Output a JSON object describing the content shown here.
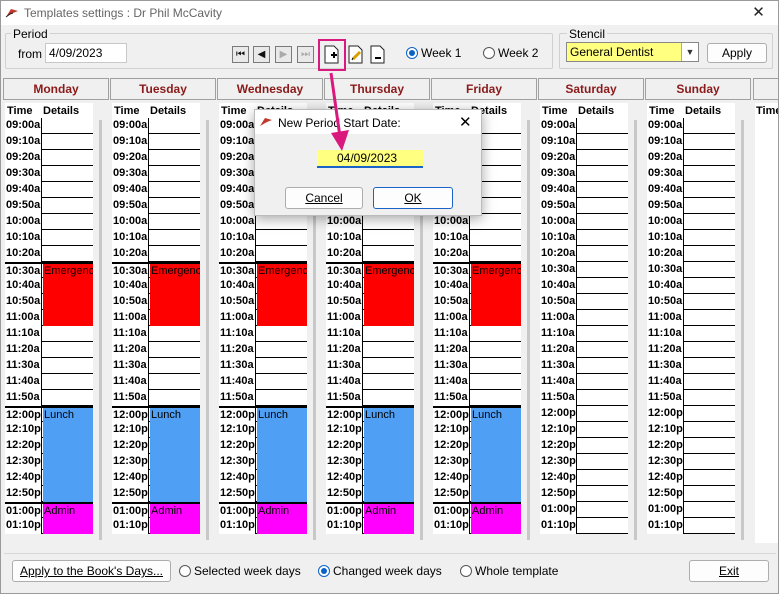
{
  "window": {
    "title": "Templates settings : Dr Phil McCavity",
    "close_glyph": "✕",
    "icon": "app-logo-icon"
  },
  "period": {
    "legend": "Period",
    "from_label": "from",
    "from_value": "4/09/2023",
    "nav_icons": [
      "first-icon",
      "prev-icon",
      "next-icon",
      "last-icon"
    ],
    "new_period_icon": "new-document-icon",
    "edit_period_icon": "edit-document-icon",
    "delete_period_icon": "delete-document-icon"
  },
  "weeks": {
    "week1": "Week 1",
    "week2": "Week 2",
    "selected": "Week 1"
  },
  "stencil": {
    "legend": "Stencil",
    "value": "General Dentist",
    "apply_label": "Apply"
  },
  "days": [
    "Monday",
    "Tuesday",
    "Wednesday",
    "Thursday",
    "Friday",
    "Saturday",
    "Sunday"
  ],
  "extra_day_header": "",
  "grid_headers": {
    "time": "Time",
    "details": "Details"
  },
  "times": [
    "09:00a",
    "09:10a",
    "09:20a",
    "09:30a",
    "09:40a",
    "09:50a",
    "10:00a",
    "10:10a",
    "10:20a",
    "10:30a",
    "10:40a",
    "10:50a",
    "11:00a",
    "11:10a",
    "11:20a",
    "11:30a",
    "11:40a",
    "11:50a",
    "12:00p",
    "12:10p",
    "12:20p",
    "12:30p",
    "12:40p",
    "12:50p",
    "01:00p",
    "01:10p"
  ],
  "blocks": [
    {
      "label": "Emergency",
      "start": 9,
      "end": 12,
      "color": "#ff0000"
    },
    {
      "label": "Lunch",
      "start": 18,
      "end": 23,
      "color": "#4f9ff5"
    },
    {
      "label": "Admin",
      "start": 24,
      "end": 25,
      "color": "#ff00ff"
    }
  ],
  "weekday_count": 5,
  "bottom": {
    "apply_book_label": "Apply to the Book's Days...",
    "selected_week_days": "Selected week days",
    "changed_week_days": "Changed week days",
    "whole_template": "Whole template",
    "selected": "Changed week days",
    "exit_label": "Exit"
  },
  "dialog": {
    "title": "New Period Start Date:",
    "value": "04/09/2023",
    "cancel_label": "Cancel",
    "ok_label": "OK",
    "close_glyph": "✕"
  },
  "colors": {
    "accent": "#d9197d",
    "day_header_text": "#8b1a1a",
    "input_highlight": "#ffff80",
    "radio_selected": "#0a62c7"
  }
}
